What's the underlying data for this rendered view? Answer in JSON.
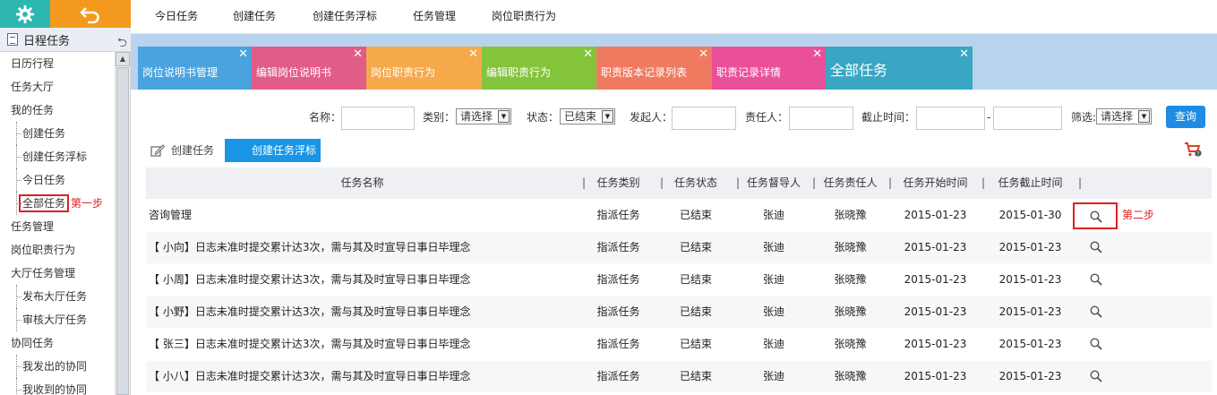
{
  "sidebar": {
    "header": "日程任务",
    "items": [
      {
        "label": "日历行程",
        "sub": false
      },
      {
        "label": "任务大厅",
        "sub": false
      },
      {
        "label": "我的任务",
        "sub": false
      },
      {
        "label": "创建任务",
        "sub": true
      },
      {
        "label": "创建任务浮标",
        "sub": true
      },
      {
        "label": "今日任务",
        "sub": true
      },
      {
        "label": "全部任务",
        "sub": true,
        "active": true
      },
      {
        "label": "任务管理",
        "sub": false
      },
      {
        "label": "岗位职责行为",
        "sub": false
      },
      {
        "label": "大厅任务管理",
        "sub": false
      },
      {
        "label": "发布大厅任务",
        "sub": true
      },
      {
        "label": "审核大厅任务",
        "sub": true
      },
      {
        "label": "协同任务",
        "sub": false
      },
      {
        "label": "我发出的协同",
        "sub": true
      },
      {
        "label": "我收到的协同",
        "sub": true
      }
    ],
    "step1": "第一步",
    "colors": {
      "gear": "#2db7b0",
      "back": "#f39a1e"
    }
  },
  "topnav": [
    "今日任务",
    "创建任务",
    "创建任务浮标",
    "任务管理",
    "岗位职责行为"
  ],
  "tabs": [
    {
      "label": "岗位说明书管理",
      "color": "#4aa3df"
    },
    {
      "label": "编辑岗位说明书",
      "color": "#e25c88"
    },
    {
      "label": "岗位职责行为",
      "color": "#f6a94b"
    },
    {
      "label": "编辑职责行为",
      "color": "#84c43a"
    },
    {
      "label": "职责版本记录列表",
      "color": "#f07a5f"
    },
    {
      "label": "职责记录详情",
      "color": "#ea4f9a"
    },
    {
      "label": "全部任务",
      "color": "#3aa6c4",
      "active": true
    }
  ],
  "filters": {
    "name_label": "名称：",
    "category_label": "类别：",
    "category_value": "请选择",
    "status_label": "状态：",
    "status_value": "已结束",
    "initiator_label": "发起人：",
    "owner_label": "责任人：",
    "deadline_label": "截止时间：",
    "range_sep": "-",
    "filter_label": "筛选:",
    "filter_value": "请选择",
    "query_button": "查询"
  },
  "actions": {
    "create_task": "创建任务",
    "create_float": "创建任务浮标"
  },
  "table": {
    "headers": [
      "任务名称",
      "任务类别",
      "任务状态",
      "任务督导人",
      "任务责任人",
      "任务开始时间",
      "任务截止时间"
    ],
    "rows": [
      {
        "name": "咨询管理",
        "category": "指派任务",
        "status": "已结束",
        "supervisor": "张迪",
        "owner": "张晓豫",
        "start": "2015-01-23",
        "end": "2015-01-30",
        "highlight": true
      },
      {
        "name": "【 小向】日志未准时提交累计达3次，需与其及时宣导日事日毕理念",
        "category": "指派任务",
        "status": "已结束",
        "supervisor": "张迪",
        "owner": "张晓豫",
        "start": "2015-01-23",
        "end": "2015-01-23"
      },
      {
        "name": "【 小周】日志未准时提交累计达3次，需与其及时宣导日事日毕理念",
        "category": "指派任务",
        "status": "已结束",
        "supervisor": "张迪",
        "owner": "张晓豫",
        "start": "2015-01-23",
        "end": "2015-01-23"
      },
      {
        "name": "【 小野】日志未准时提交累计达3次，需与其及时宣导日事日毕理念",
        "category": "指派任务",
        "status": "已结束",
        "supervisor": "张迪",
        "owner": "张晓豫",
        "start": "2015-01-23",
        "end": "2015-01-23"
      },
      {
        "name": "【 张三】日志未准时提交累计达3次，需与其及时宣导日事日毕理念",
        "category": "指派任务",
        "status": "已结束",
        "supervisor": "张迪",
        "owner": "张晓豫",
        "start": "2015-01-23",
        "end": "2015-01-23"
      },
      {
        "name": "【 小八】日志未准时提交累计达3次，需与其及时宣导日事日毕理念",
        "category": "指派任务",
        "status": "已结束",
        "supervisor": "张迪",
        "owner": "张晓豫",
        "start": "2015-01-23",
        "end": "2015-01-23"
      }
    ],
    "step2": "第二步"
  }
}
